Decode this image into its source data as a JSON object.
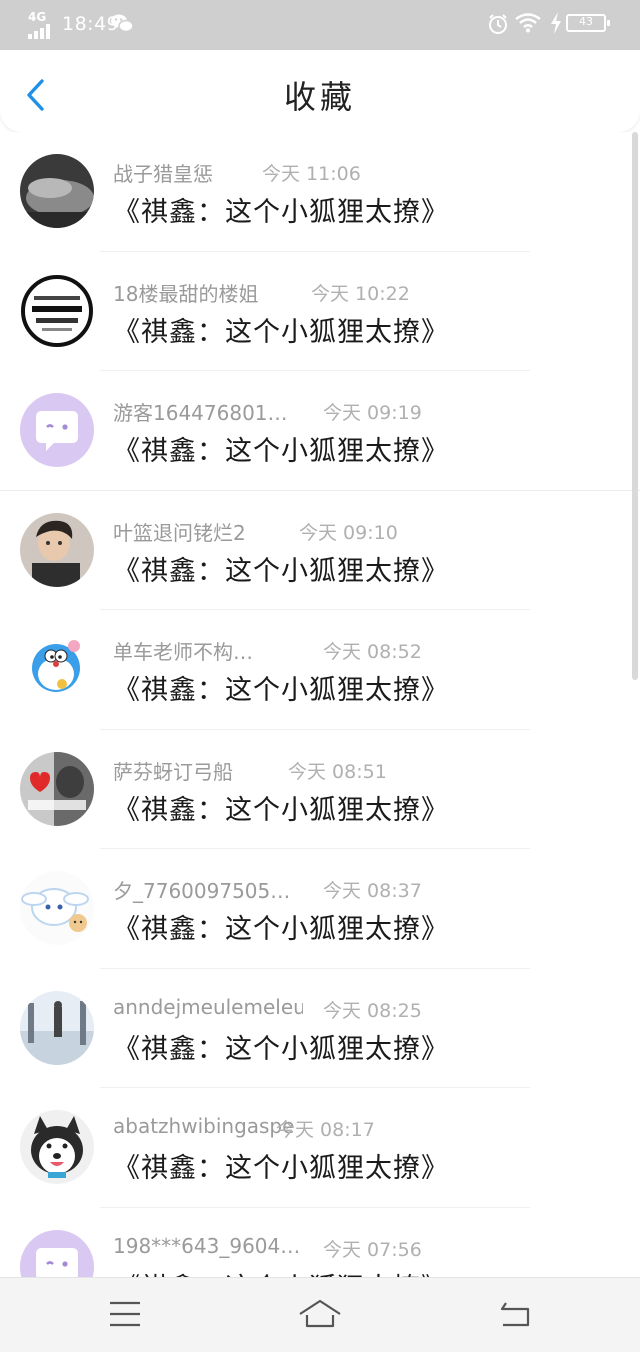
{
  "status_bar": {
    "network": "4G",
    "time": "18:49",
    "battery": "43"
  },
  "header": {
    "title": "收藏"
  },
  "favorites": [
    {
      "name": "战子猎皇惩",
      "time": "今天  11:06",
      "text": "《祺鑫：这个小狐狸太撩》",
      "avatar": "avatar-gray-pillow"
    },
    {
      "name": "18楼最甜的楼姐",
      "time": "今天  10:22",
      "text": "《祺鑫：这个小狐狸太撩》",
      "avatar": "avatar-text-badge"
    },
    {
      "name": "游客164476801…",
      "time": "今天  09:19",
      "text": "《祺鑫：这个小狐狸太撩》",
      "avatar": "avatar-default-chat"
    },
    {
      "name": "叶篮退问铑烂2",
      "time": "今天  09:10",
      "text": "《祺鑫：这个小狐狸太撩》",
      "avatar": "avatar-young-man"
    },
    {
      "name": "单车老师不构…",
      "time": "今天  08:52",
      "text": "《祺鑫：这个小狐狸太撩》",
      "avatar": "avatar-doraemon"
    },
    {
      "name": "萨芬蚜订弓船",
      "time": "今天  08:51",
      "text": "《祺鑫：这个小狐狸太撩》",
      "avatar": "avatar-couple-heart"
    },
    {
      "name": "夕_7760097505…",
      "time": "今天  08:37",
      "text": "《祺鑫：这个小狐狸太撩》",
      "avatar": "avatar-cinnamoroll"
    },
    {
      "name": "anndejmeulemeleu…",
      "time": "今天  08:25",
      "text": "《祺鑫：这个小狐狸太撩》",
      "avatar": "avatar-city-window"
    },
    {
      "name": "abatzhwibingaspe",
      "time": "今天  08:17",
      "text": "《祺鑫：这个小狐狸太撩》",
      "avatar": "avatar-husky-dog"
    },
    {
      "name": "198***643_9604…",
      "time": "今天  07:56",
      "text": "《祺鑫：这个小狐狸太撩》",
      "avatar": "avatar-default-chat"
    }
  ],
  "colors": {
    "accent": "#1e90e8",
    "default_avatar": "#d9c8f2",
    "status_bar_bg": "#cfcfcf"
  }
}
